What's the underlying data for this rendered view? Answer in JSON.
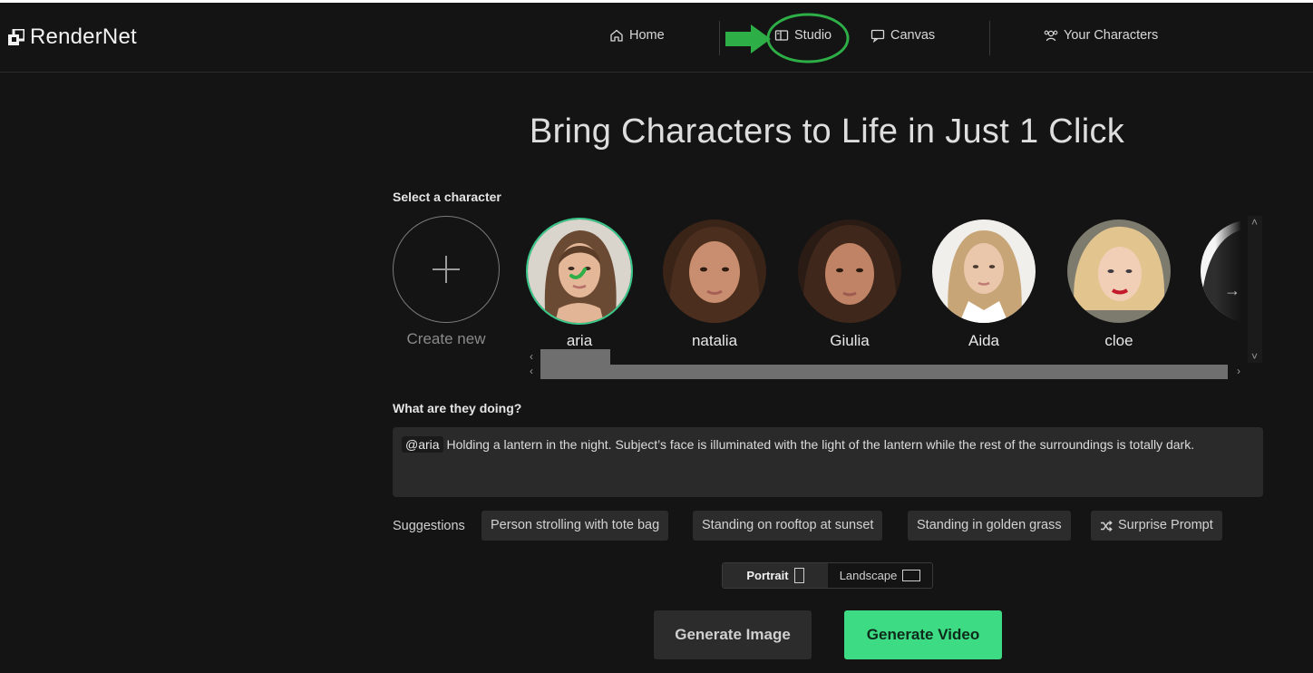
{
  "app": {
    "name": "RenderNet"
  },
  "nav": {
    "home": "Home",
    "studio": "Studio",
    "canvas": "Canvas",
    "characters": "Your Characters"
  },
  "hero": {
    "title": "Bring Characters to Life in Just 1 Click"
  },
  "characters": {
    "section_label": "Select a character",
    "create_label": "Create new",
    "items": [
      {
        "name": "aria",
        "selected": true
      },
      {
        "name": "natalia"
      },
      {
        "name": "Giulia"
      },
      {
        "name": "Aida"
      },
      {
        "name": "cloe"
      }
    ]
  },
  "prompt": {
    "section_label": "What are they doing?",
    "mention": "@aria",
    "text": "Holding a lantern in the night. Subject’s face is illuminated with the light of the lantern while the rest of the surroundings is totally dark."
  },
  "suggestions": {
    "label": "Suggestions",
    "items": [
      "Person strolling with tote bag",
      "Standing on rooftop at sunset",
      "Standing in golden grass"
    ],
    "surprise": "Surprise Prompt"
  },
  "orientation": {
    "portrait": "Portrait",
    "landscape": "Landscape",
    "selected": "Portrait"
  },
  "actions": {
    "generate_image": "Generate Image",
    "generate_video": "Generate Video"
  },
  "colors": {
    "accent": "#3ddc84",
    "background": "#141414",
    "annotation": "#2eae47"
  }
}
